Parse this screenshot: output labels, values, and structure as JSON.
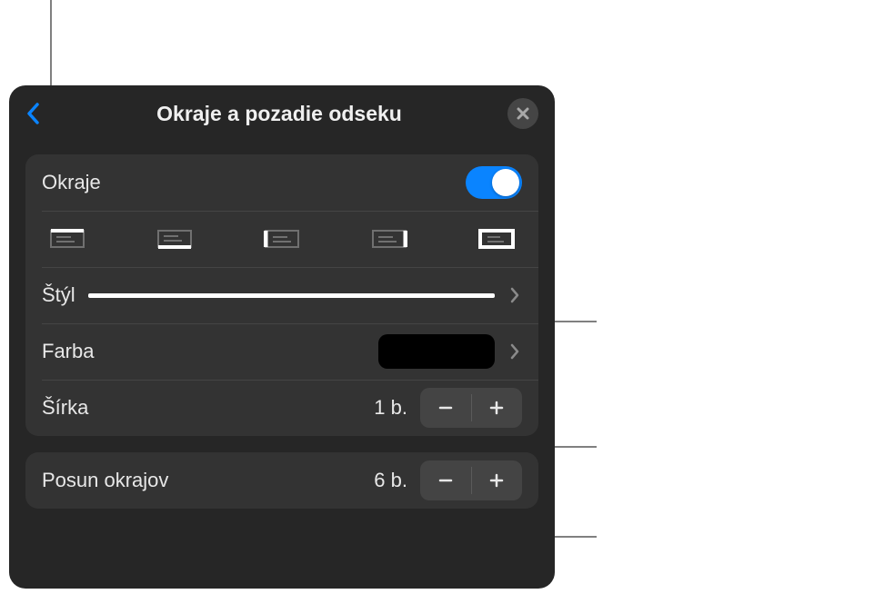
{
  "panel": {
    "title": "Okraje a pozadie odseku",
    "borders": {
      "label": "Okraje",
      "toggle_on": true
    },
    "style": {
      "label": "Štýl"
    },
    "color": {
      "label": "Farba",
      "value": "#000000"
    },
    "width": {
      "label": "Šírka",
      "value": "1 b."
    },
    "offset": {
      "label": "Posun okrajov",
      "value": "6 b."
    }
  }
}
